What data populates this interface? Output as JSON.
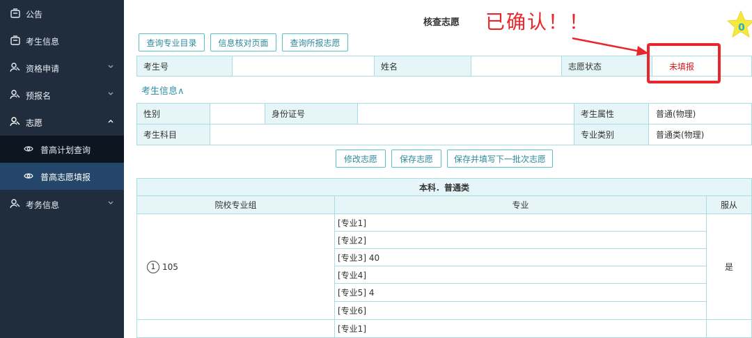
{
  "sidebar": {
    "items": [
      {
        "label": "公告",
        "icon": "notice-icon",
        "arrow": ""
      },
      {
        "label": "考生信息",
        "icon": "id-card-icon",
        "arrow": ""
      },
      {
        "label": "资格申请",
        "icon": "user-link-icon",
        "arrow": "down"
      },
      {
        "label": "预报名",
        "icon": "user-link-icon",
        "arrow": "down"
      },
      {
        "label": "志愿",
        "icon": "user-link-icon",
        "arrow": "up"
      },
      {
        "label": "考务信息",
        "icon": "user-link-icon",
        "arrow": "down"
      }
    ],
    "sub_items": [
      {
        "label": "普高计划查询",
        "icon": "eye-icon",
        "active": false
      },
      {
        "label": "普高志愿填报",
        "icon": "eye-icon",
        "active": true
      }
    ]
  },
  "header": {
    "title": "核查志愿",
    "annotation": "已确认！！",
    "star_value": "0"
  },
  "toolbar": {
    "buttons": [
      "查询专业目录",
      "信息核对页面",
      "查询所报志愿"
    ]
  },
  "status_row": {
    "exam_no_label": "考生号",
    "exam_no_value": "",
    "name_label": "姓名",
    "name_value": "",
    "status_label": "志愿状态",
    "status_value": "未填报"
  },
  "student_info": {
    "toggle": "考生信息∧",
    "gender_label": "性别",
    "gender_value": "",
    "id_label": "身份证号",
    "id_value": "",
    "attr_label": "考生属性",
    "attr_value": "普通(物理)",
    "subject_label": "考生科目",
    "subject_value": "",
    "category_label": "专业类别",
    "category_value": "普通类(物理)"
  },
  "actions": {
    "buttons": [
      "修改志愿",
      "保存志愿",
      "保存并填写下一批次志愿"
    ]
  },
  "table": {
    "title": "本科．普通类",
    "columns": [
      "院校专业组",
      "专业",
      "服从"
    ],
    "group_no": "1",
    "group_code": "105",
    "majors": [
      "[专业1]",
      "[专业2]",
      "[专业3] 40",
      "[专业4]",
      "[专业5] 4",
      "[专业6]",
      "[专业1]"
    ],
    "obey": "是"
  },
  "colors": {
    "sidebar_bg": "#1f2d3d",
    "sidebar_active": "#24466a",
    "accent": "#2d8a99",
    "alert": "#e8262c",
    "table_header": "#e6f6f8"
  }
}
